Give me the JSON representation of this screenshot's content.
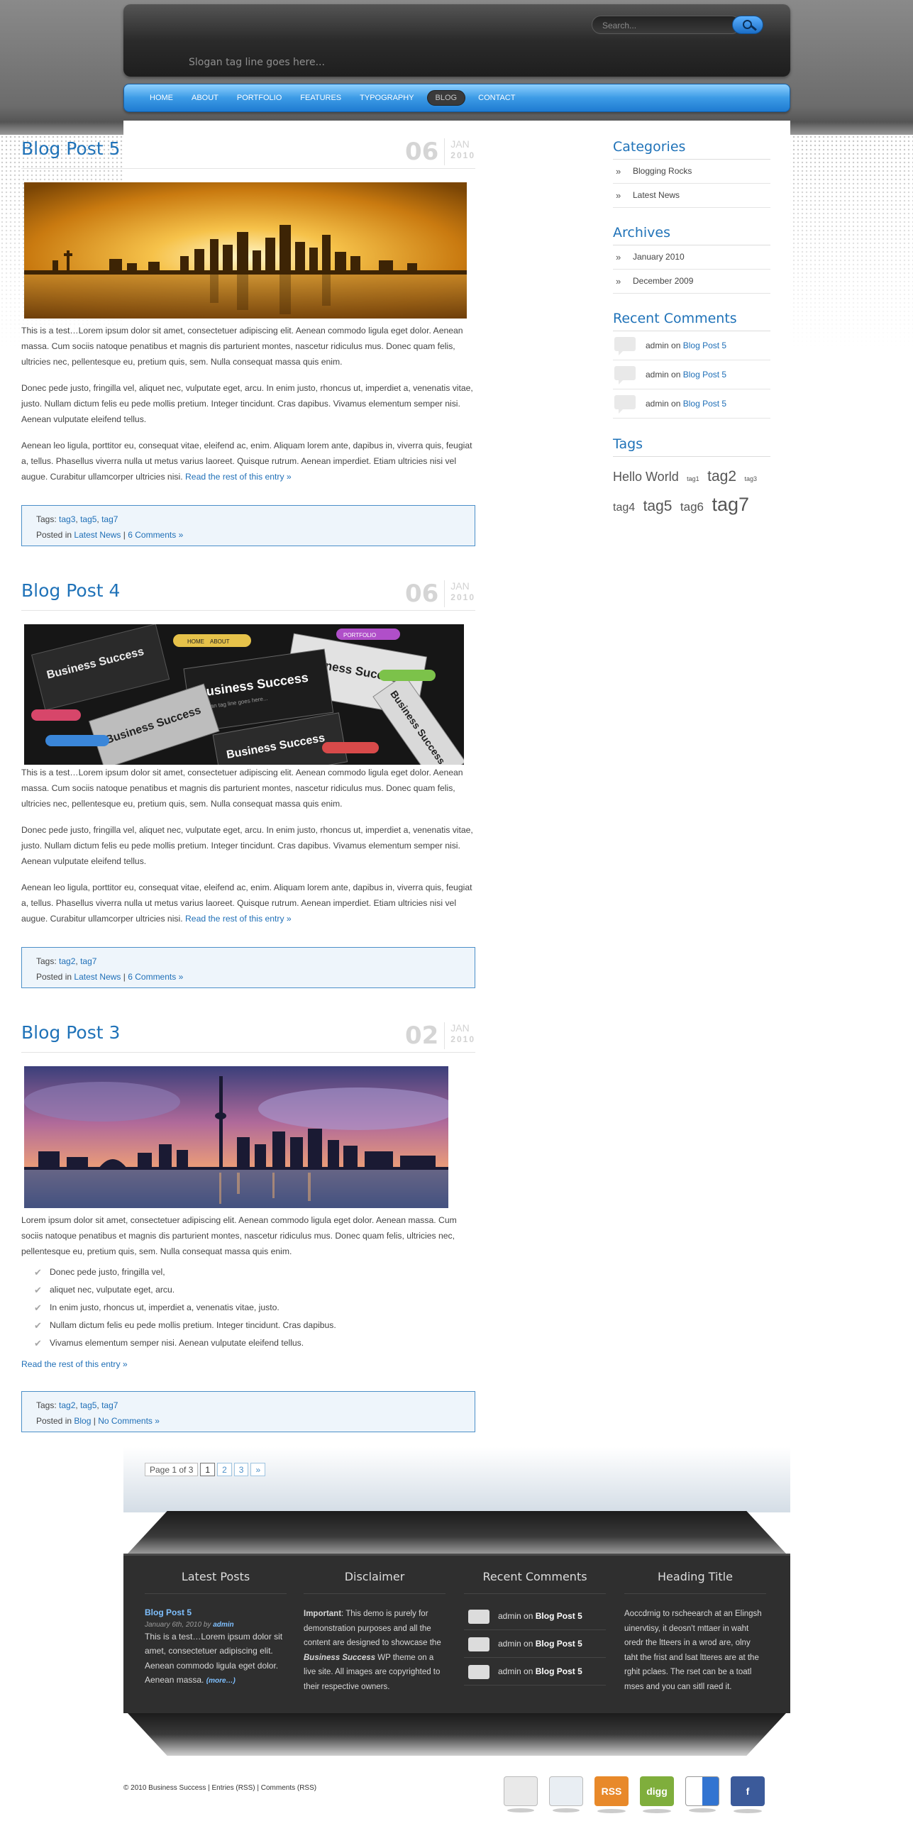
{
  "header": {
    "tagline": "Slogan tag line goes here...",
    "search_placeholder": "Search..."
  },
  "nav": [
    "HOME",
    "ABOUT",
    "PORTFOLIO",
    "FEATURES",
    "TYPOGRAPHY",
    "BLOG",
    "CONTACT"
  ],
  "nav_active": "BLOG",
  "posts": [
    {
      "title": "Blog Post 5",
      "day": "06",
      "month": "JAN",
      "year": "2010",
      "image_label": "city-skyline-sunset",
      "paragraphs": [
        "This is a test…Lorem ipsum dolor sit amet, consectetuer adipiscing elit. Aenean commodo ligula eget dolor. Aenean massa. Cum sociis natoque penatibus et magnis dis parturient montes, nascetur ridiculus mus. Donec quam felis, ultricies nec, pellentesque eu, pretium quis, sem. Nulla consequat massa quis enim.",
        "Donec pede justo, fringilla vel, aliquet nec, vulputate eget, arcu. In enim justo, rhoncus ut, imperdiet a, venenatis vitae, justo. Nullam dictum felis eu pede mollis pretium. Integer tincidunt. Cras dapibus. Vivamus elementum semper nisi. Aenean vulputate eleifend tellus.",
        "Aenean leo ligula, porttitor eu, consequat vitae, eleifend ac, enim. Aliquam lorem ante, dapibus in, viverra quis, feugiat a, tellus. Phasellus viverra nulla ut metus varius laoreet. Quisque rutrum. Aenean imperdiet. Etiam ultricies nisi vel augue. Curabitur ullamcorper ultricies nisi."
      ],
      "read_more": "Read the rest of this entry »",
      "tags_label": "Tags:",
      "tags": [
        "tag3",
        "tag5",
        "tag7"
      ],
      "posted_in_label": "Posted in",
      "category": "Latest News",
      "comments": "6 Comments »"
    },
    {
      "title": "Blog Post 4",
      "day": "06",
      "month": "JAN",
      "year": "2010",
      "image_label": "business-success-cards",
      "paragraphs": [
        "This is a test…Lorem ipsum dolor sit amet, consectetuer adipiscing elit. Aenean commodo ligula eget dolor. Aenean massa. Cum sociis natoque penatibus et magnis dis parturient montes, nascetur ridiculus mus. Donec quam felis, ultricies nec, pellentesque eu, pretium quis, sem. Nulla consequat massa quis enim.",
        "Donec pede justo, fringilla vel, aliquet nec, vulputate eget, arcu. In enim justo, rhoncus ut, imperdiet a, venenatis vitae, justo. Nullam dictum felis eu pede mollis pretium. Integer tincidunt. Cras dapibus. Vivamus elementum semper nisi. Aenean vulputate eleifend tellus.",
        "Aenean leo ligula, porttitor eu, consequat vitae, eleifend ac, enim. Aliquam lorem ante, dapibus in, viverra quis, feugiat a, tellus. Phasellus viverra nulla ut metus varius laoreet. Quisque rutrum. Aenean imperdiet. Etiam ultricies nisi vel augue. Curabitur ullamcorper ultricies nisi."
      ],
      "read_more": "Read the rest of this entry »",
      "tags_label": "Tags:",
      "tags": [
        "tag2",
        "tag7"
      ],
      "posted_in_label": "Posted in",
      "category": "Latest News",
      "comments": "6 Comments »",
      "card_texts": [
        "Business Success",
        "Slogan tag line goes here...",
        "HOME",
        "ABOUT",
        "PORTFOLIO"
      ]
    },
    {
      "title": "Blog Post 3",
      "day": "02",
      "month": "JAN",
      "year": "2010",
      "image_label": "toronto-skyline-dusk",
      "paragraphs": [
        "Lorem ipsum dolor sit amet, consectetuer adipiscing elit. Aenean commodo ligula eget dolor. Aenean massa. Cum sociis natoque penatibus et magnis dis parturient montes, nascetur ridiculus mus. Donec quam felis, ultricies nec, pellentesque eu, pretium quis, sem. Nulla consequat massa quis enim."
      ],
      "list": [
        "Donec pede justo, fringilla vel,",
        "aliquet nec, vulputate eget, arcu.",
        "In enim justo, rhoncus ut, imperdiet a, venenatis vitae, justo.",
        "Nullam dictum felis eu pede mollis pretium. Integer tincidunt. Cras dapibus.",
        "Vivamus elementum semper nisi. Aenean vulputate eleifend tellus."
      ],
      "read_more": "Read the rest of this entry »",
      "tags_label": "Tags:",
      "tags": [
        "tag2",
        "tag5",
        "tag7"
      ],
      "posted_in_label": "Posted in",
      "category": "Blog",
      "comments": "No Comments »"
    }
  ],
  "pagination": {
    "label": "Page 1 of 3",
    "pages": [
      "1",
      "2",
      "3"
    ],
    "next": "»"
  },
  "sidebar": {
    "categories_title": "Categories",
    "categories": [
      "Blogging Rocks",
      "Latest News"
    ],
    "archives_title": "Archives",
    "archives": [
      "January 2010",
      "December 2009"
    ],
    "recent_comments_title": "Recent Comments",
    "recent_comments": [
      {
        "author": "admin",
        "on": "on",
        "post": "Blog Post 5"
      },
      {
        "author": "admin",
        "on": "on",
        "post": "Blog Post 5"
      },
      {
        "author": "admin",
        "on": "on",
        "post": "Blog Post 5"
      }
    ],
    "tags_title": "Tags",
    "tags": [
      "Hello World",
      "tag1",
      "tag2",
      "tag3",
      "tag4",
      "tag5",
      "tag6",
      "tag7"
    ]
  },
  "footer": {
    "latest_posts_title": "Latest Posts",
    "latest_post_title": "Blog Post 5",
    "latest_post_date": "January 6th, 2010",
    "latest_post_by": "by",
    "latest_post_author": "admin",
    "latest_post_excerpt": "This is a test…Lorem ipsum dolor sit amet, consectetuer adipiscing elit. Aenean commodo ligula eget dolor. Aenean massa.",
    "latest_post_more": "(more…)",
    "disclaimer_title": "Disclaimer",
    "disclaimer_strong": "Important",
    "disclaimer_a": ": This demo is purely for demonstration purposes and all the content are designed to showcase the",
    "disclaimer_theme": "Business Success",
    "disclaimer_b": "WP theme on a live site. All images are copyrighted to their respective owners.",
    "recent_comments_title": "Recent Comments",
    "recent_comments": [
      {
        "author": "admin",
        "on": "on",
        "post": "Blog Post 5"
      },
      {
        "author": "admin",
        "on": "on",
        "post": "Blog Post 5"
      },
      {
        "author": "admin",
        "on": "on",
        "post": "Blog Post 5"
      }
    ],
    "heading_title": "Heading Title",
    "heading_text": "Aoccdrnig to rscheearch at an Elingsh uinervtisy, it deosn't mttaer in waht oredr the ltteers in a wrod are, olny taht the frist and lsat ltteres are at the rghit pclaes. The rset can be a toatl mses and you can sitll raed it."
  },
  "copyright": {
    "text": "© 2010 Business Success | Entries (RSS) | Comments (RSS)"
  },
  "social": [
    {
      "name": "email-icon",
      "label": "",
      "color": "#e9e9e9"
    },
    {
      "name": "twitter-icon",
      "label": "",
      "color": "#e9eef3"
    },
    {
      "name": "rss-icon",
      "label": "RSS",
      "color": "#e8892a"
    },
    {
      "name": "digg-icon",
      "label": "digg",
      "color": "#7fae3c"
    },
    {
      "name": "delicious-icon",
      "label": "",
      "color": "#e8e8e8"
    },
    {
      "name": "facebook-icon",
      "label": "f",
      "color": "#3b5a9a"
    }
  ],
  "colors": {
    "link": "#1f72b8",
    "nav": "#3c9be6"
  }
}
